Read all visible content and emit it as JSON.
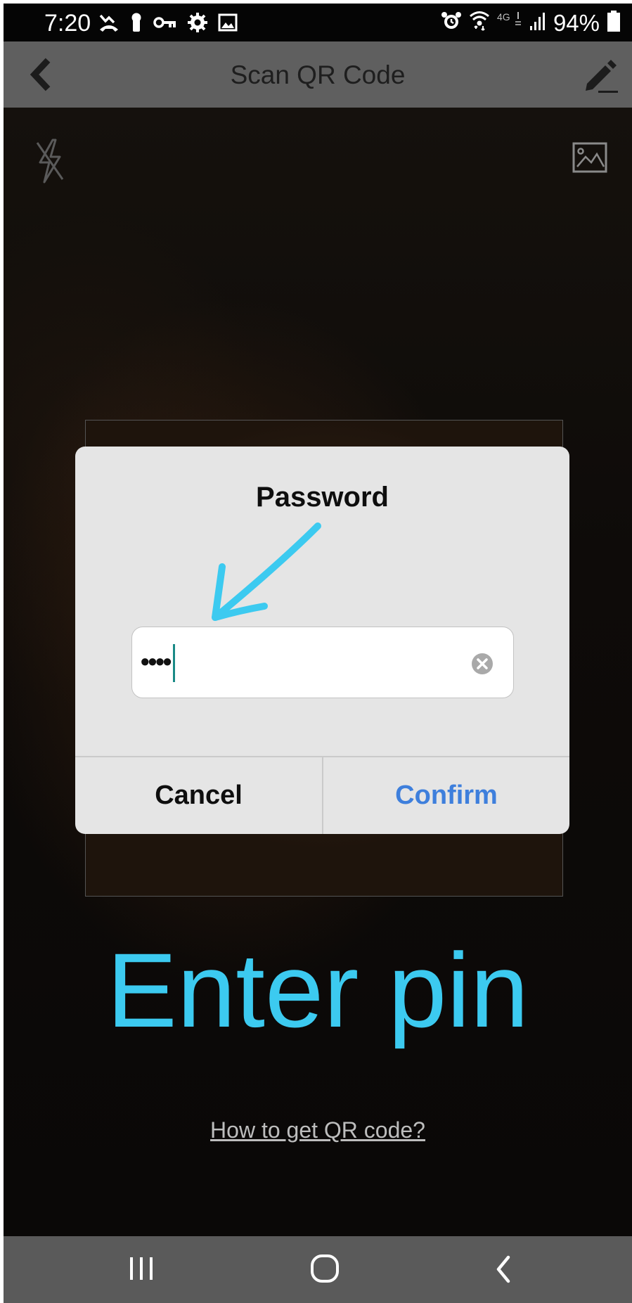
{
  "status_bar": {
    "time": "7:20",
    "battery_percent": "94%",
    "left_icons": [
      "missed-call-icon",
      "keyhole-icon",
      "vpn-key-icon",
      "gear-settings-icon",
      "image-icon"
    ],
    "right_icons": [
      "alarm-icon",
      "wifi-icon",
      "lte-4g-icon",
      "signal-bars-icon",
      "battery-icon"
    ],
    "network_label": "4G"
  },
  "header": {
    "title": "Scan QR Code",
    "back_icon": "chevron-left-icon",
    "edit_icon": "pencil-icon"
  },
  "camera_controls": {
    "flash_icon": "flash-off-icon",
    "gallery_icon": "gallery-image-icon"
  },
  "dialog": {
    "title": "Password",
    "password_value": "••••",
    "clear_icon": "clear-x-icon",
    "cancel_label": "Cancel",
    "confirm_label": "Confirm"
  },
  "annotation": {
    "text": "Enter pin",
    "arrow_icon": "pointer-arrow-icon"
  },
  "help_link": {
    "label": "How to get QR code?"
  },
  "navigation_bar": {
    "recents_icon": "recent-apps-icon",
    "home_icon": "home-icon",
    "back_icon": "back-arrow-icon"
  },
  "colors": {
    "accent_annotation": "#3ccaf0",
    "confirm_button": "#3e7fdc",
    "dialog_bg": "#e5e5e5",
    "title_bar_bg": "#5f5f5f",
    "nav_bar_bg": "#5a5a5a"
  }
}
